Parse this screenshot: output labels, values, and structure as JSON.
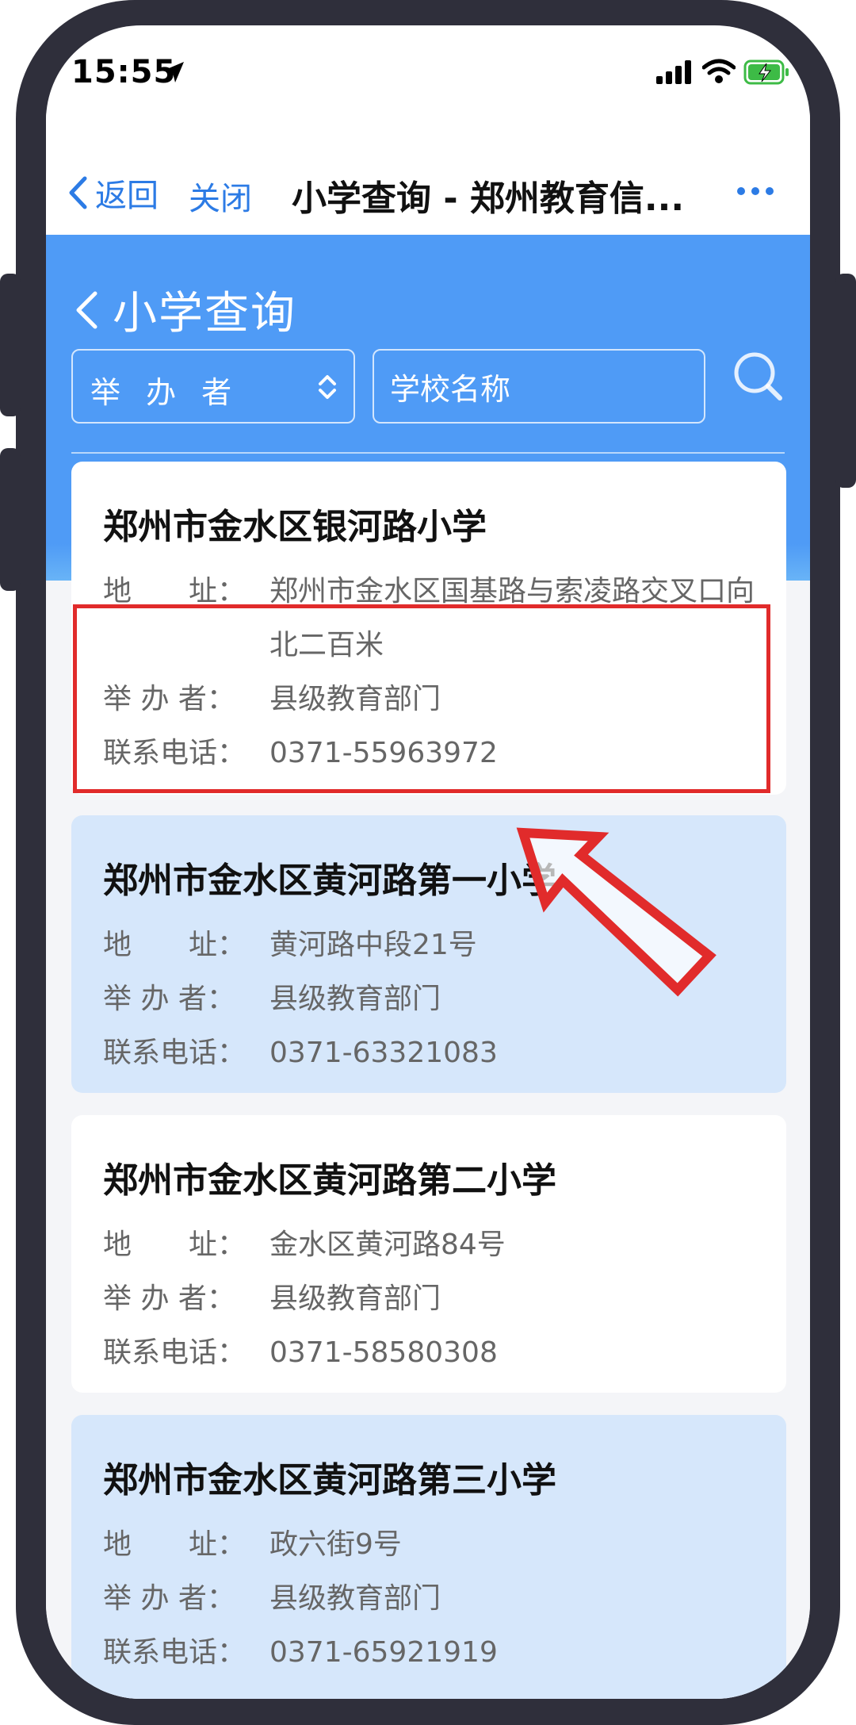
{
  "status": {
    "time": "15:55"
  },
  "nav": {
    "back": "返回",
    "close": "关闭",
    "title": "小学查询 - 郑州教育信..."
  },
  "header": {
    "page_title": "小学查询",
    "sponsor_select": "举 办 者",
    "school_name_placeholder": "学校名称"
  },
  "labels": {
    "address": "地　　址：",
    "sponsor": "举 办 者：",
    "phone": "联系电话："
  },
  "schools": [
    {
      "name": "郑州市金水区银河路小学",
      "address": "郑州市金水区国基路与索凌路交叉口向北二百米",
      "sponsor": "县级教育部门",
      "phone": "0371-55963972"
    },
    {
      "name": "郑州市金水区黄河路第一小学",
      "address": "黄河路中段21号",
      "sponsor": "县级教育部门",
      "phone": "0371-63321083"
    },
    {
      "name": "郑州市金水区黄河路第二小学",
      "address": "金水区黄河路84号",
      "sponsor": "县级教育部门",
      "phone": "0371-58580308"
    },
    {
      "name": "郑州市金水区黄河路第三小学",
      "address": "政六街9号",
      "sponsor": "县级教育部门",
      "phone": "0371-65921919"
    }
  ],
  "colors": {
    "accent": "#4f9bf6",
    "link": "#2c7be5",
    "highlight": "#e12b2b",
    "card_alt": "#d6e7fb"
  }
}
